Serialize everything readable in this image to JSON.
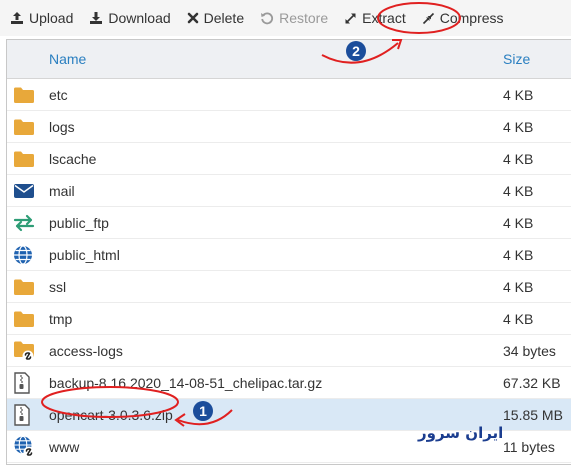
{
  "toolbar": {
    "upload": "Upload",
    "download": "Download",
    "delete": "Delete",
    "restore": "Restore",
    "extract": "Extract",
    "compress": "Compress"
  },
  "table": {
    "col_name": "Name",
    "col_size": "Size",
    "rows": [
      {
        "name": "etc",
        "size": "4 KB",
        "icon": "folder-icon"
      },
      {
        "name": "logs",
        "size": "4 KB",
        "icon": "folder-icon"
      },
      {
        "name": "lscache",
        "size": "4 KB",
        "icon": "folder-icon"
      },
      {
        "name": "mail",
        "size": "4 KB",
        "icon": "mail-folder-icon"
      },
      {
        "name": "public_ftp",
        "size": "4 KB",
        "icon": "ftp-folder-icon"
      },
      {
        "name": "public_html",
        "size": "4 KB",
        "icon": "globe-icon"
      },
      {
        "name": "ssl",
        "size": "4 KB",
        "icon": "folder-icon"
      },
      {
        "name": "tmp",
        "size": "4 KB",
        "icon": "folder-icon"
      },
      {
        "name": "access-logs",
        "size": "34 bytes",
        "icon": "folder-link-icon"
      },
      {
        "name": "backup-8.16.2020_14-08-51_chelipac.tar.gz",
        "size": "67.32 KB",
        "icon": "archive-file-icon"
      },
      {
        "name": "opencart-3.0.3.6.zip",
        "size": "15.85 MB",
        "icon": "archive-file-icon"
      },
      {
        "name": "www",
        "size": "11 bytes",
        "icon": "globe-link-icon"
      }
    ]
  },
  "annotations": {
    "step1": "1",
    "step2": "2",
    "watermark": "ایران سرور"
  },
  "colors": {
    "accent_blue": "#2a7fc0",
    "folder": "#e8a83a",
    "annotation_red": "#e02020",
    "badge_blue": "#1b4d9b",
    "selected_row": "#d9e8f6"
  }
}
